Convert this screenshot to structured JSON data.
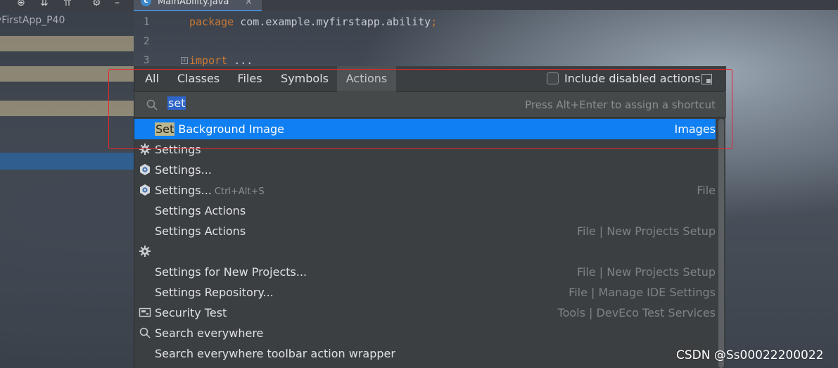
{
  "editor": {
    "tab_label": "MainAbility.java",
    "tab_close": "×",
    "project_label": "yFirstApp_P40",
    "line_numbers": [
      "1",
      "2",
      "3"
    ],
    "code": {
      "line1_kw": "package",
      "line1_rest": " com.example.myfirstapp.ability",
      "line1_semi": ";",
      "line3_kw": "import",
      "line3_rest": " ..."
    }
  },
  "popup": {
    "tabs": [
      {
        "label": "All"
      },
      {
        "label": "Classes"
      },
      {
        "label": "Files"
      },
      {
        "label": "Symbols"
      },
      {
        "label": "Actions",
        "active": true
      }
    ],
    "include_disabled": {
      "label": "Include disabled actions",
      "checked": false
    },
    "search": {
      "value": "set",
      "hint": "Press Alt+Enter to assign a shortcut"
    },
    "results": [
      {
        "match": "Set",
        "rest": " Background Image",
        "location": "Images",
        "icon": "none",
        "selected": true
      },
      {
        "match": "",
        "rest": "Settings",
        "location": "",
        "icon": "gear-icon"
      },
      {
        "match": "",
        "rest": "Settings...",
        "location": "",
        "icon": "devEco-settings-icon"
      },
      {
        "match": "",
        "rest": "Settings...",
        "shortcut": "Ctrl+Alt+S",
        "location": "File",
        "icon": "devEco-settings-icon"
      },
      {
        "match": "",
        "rest": "Settings Actions",
        "location": "",
        "icon": "none"
      },
      {
        "match": "",
        "rest": "Settings Actions",
        "location": "File | New Projects Setup",
        "icon": "none"
      },
      {
        "match": "",
        "rest": "",
        "location": "",
        "icon": "gear-icon"
      },
      {
        "match": "",
        "rest": "Settings for New Projects...",
        "location": "File | New Projects Setup",
        "icon": "none"
      },
      {
        "match": "",
        "rest": "Settings Repository...",
        "location": "File | Manage IDE Settings",
        "icon": "none"
      },
      {
        "match": "",
        "rest": "Security Test",
        "location": "Tools | DevEco Test Services",
        "icon": "security-test-icon"
      },
      {
        "match": "",
        "rest": "Search everywhere",
        "location": "",
        "icon": "search-icon"
      },
      {
        "match": "",
        "rest": "Search everywhere toolbar action wrapper",
        "location": "",
        "icon": "none"
      }
    ]
  },
  "watermark": "CSDN @Ss00022200022",
  "colors": {
    "selection": "#0f7ff1",
    "annotation": "#e8262b",
    "popup_bg": "#3c3f41"
  }
}
